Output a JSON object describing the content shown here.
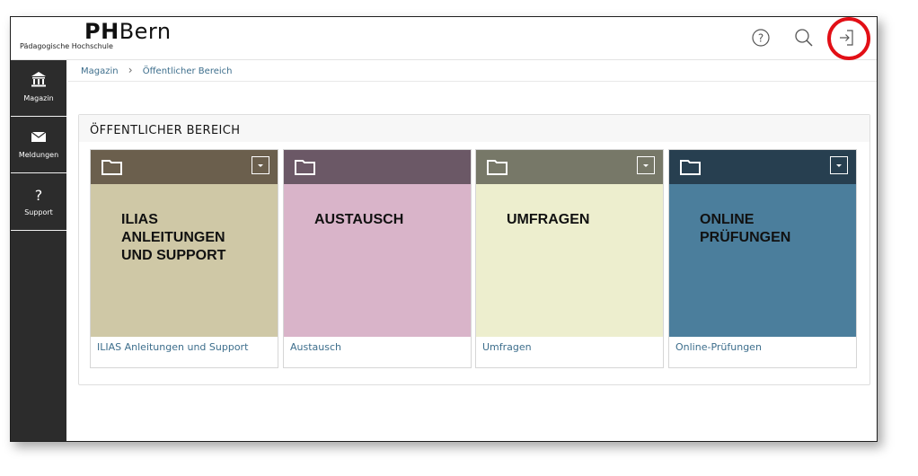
{
  "header": {
    "logo_strong": "PH",
    "logo_rest": "Bern",
    "logo_sub": "Pädagogische Hochschule"
  },
  "sidebar": {
    "items": [
      {
        "label": "Magazin",
        "icon": "bank-icon"
      },
      {
        "label": "Meldungen",
        "icon": "envelope-icon"
      },
      {
        "label": "Support",
        "icon": "question-icon"
      }
    ]
  },
  "breadcrumb": {
    "items": [
      "Magazin",
      "Öffentlicher Bereich"
    ]
  },
  "panel": {
    "title": "ÖFFENTLICHER BEREICH"
  },
  "tiles": [
    {
      "tile_text": "ILIAS\nANLEITUNGEN\nUND SUPPORT",
      "caption": "ILIAS Anleitungen und Support",
      "head_color": "#6b5f4d",
      "body_color": "#cfc8a6"
    },
    {
      "tile_text": "AUSTAUSCH",
      "caption": "Austausch",
      "head_color": "#6b5866",
      "body_color": "#d9b4c9"
    },
    {
      "tile_text": "UMFRAGEN",
      "caption": "Umfragen",
      "head_color": "#777868",
      "body_color": "#edeece"
    },
    {
      "tile_text": "ONLINE\nPRÜFUNGEN",
      "caption": "Online-Prüfungen",
      "head_color": "#273f50",
      "body_color": "#4b7e9c"
    }
  ],
  "colors": {
    "sidebar_bg": "#2c2c2c",
    "link": "#3d6e8c",
    "highlight_circle": "#e20f16"
  }
}
